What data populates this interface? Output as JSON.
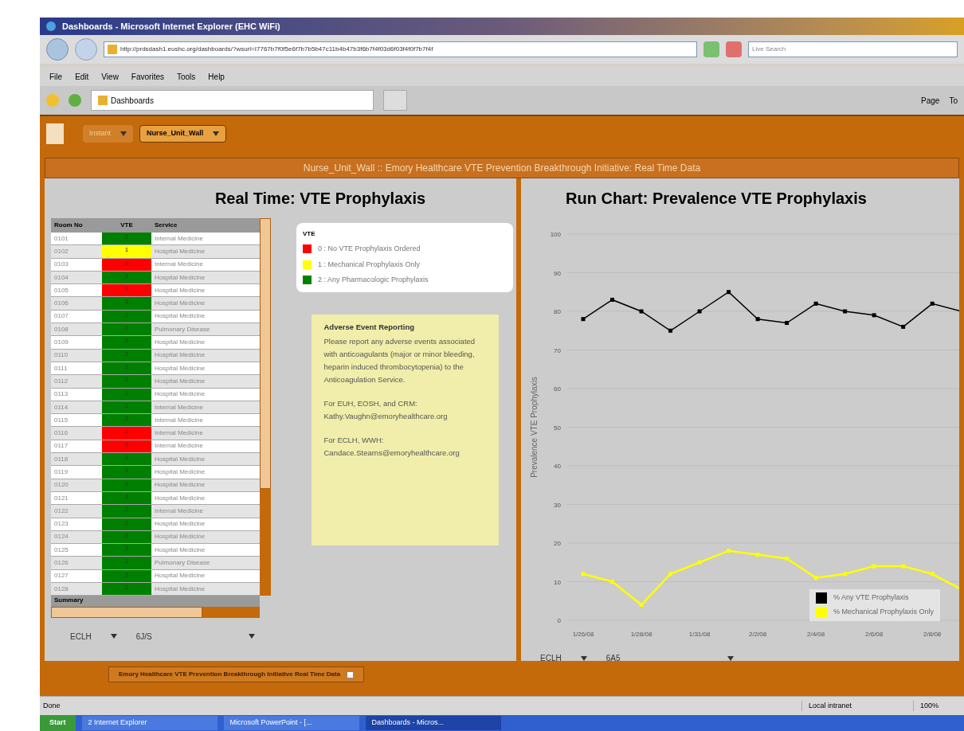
{
  "window": {
    "title": "Dashboards - Microsoft Internet Explorer (EHC WiFi)"
  },
  "address_bar": {
    "value": "http://prdsdash1.eushc.org/dashboards/?wsurl=I7767b7f0f5e6f7b7b5b47c11b4b47b3f6b7f4f03d6f03f4f0f7b7f4f",
    "search_placeholder": "Live Search"
  },
  "menu": [
    "File",
    "Edit",
    "View",
    "Favorites",
    "Tools",
    "Help"
  ],
  "browser_tab": {
    "label": "Dashboards"
  },
  "command_bar": [
    "Page",
    "To"
  ],
  "app_toolbar": [
    {
      "label": "Instant",
      "selected": false
    },
    {
      "label": "Nurse_Unit_Wall",
      "selected": true
    }
  ],
  "panel_title": "Nurse_Unit_Wall :: Emory Healthcare VTE Prevention Breakthrough Initiative: Real Time Data",
  "left_panel": {
    "title": "Real Time: VTE Prophylaxis",
    "table": {
      "columns": [
        "Room No",
        "VTE",
        "Service"
      ],
      "rows": [
        {
          "room": "0101",
          "vte": "2",
          "service": "Internal Medicine",
          "color": "#008000"
        },
        {
          "room": "0102",
          "vte": "1",
          "service": "Hospital Medicine",
          "color": "#ffff00"
        },
        {
          "room": "0103",
          "vte": "0",
          "service": "Internal Medicine",
          "color": "#ff0000"
        },
        {
          "room": "0104",
          "vte": "2",
          "service": "Hospital Medicine",
          "color": "#008000"
        },
        {
          "room": "0105",
          "vte": "0",
          "service": "Hospital Medicine",
          "color": "#ff0000"
        },
        {
          "room": "0106",
          "vte": "2",
          "service": "Hospital Medicine",
          "color": "#008000"
        },
        {
          "room": "0107",
          "vte": "2",
          "service": "Hospital Medicine",
          "color": "#008000"
        },
        {
          "room": "0108",
          "vte": "2",
          "service": "Pulmonary Disease",
          "color": "#008000"
        },
        {
          "room": "0109",
          "vte": "2",
          "service": "Hospital Medicine",
          "color": "#008000"
        },
        {
          "room": "0110",
          "vte": "2",
          "service": "Hospital Medicine",
          "color": "#008000"
        },
        {
          "room": "0111",
          "vte": "2",
          "service": "Hospital Medicine",
          "color": "#008000"
        },
        {
          "room": "0112",
          "vte": "2",
          "service": "Hospital Medicine",
          "color": "#008000"
        },
        {
          "room": "0113",
          "vte": "2",
          "service": "Hospital Medicine",
          "color": "#008000"
        },
        {
          "room": "0114",
          "vte": "2",
          "service": "Internal Medicine",
          "color": "#008000"
        },
        {
          "room": "0115",
          "vte": "2",
          "service": "Internal Medicine",
          "color": "#008000"
        },
        {
          "room": "0116",
          "vte": "0",
          "service": "Internal Medicine",
          "color": "#ff0000"
        },
        {
          "room": "0117",
          "vte": "0",
          "service": "Internal Medicine",
          "color": "#ff0000"
        },
        {
          "room": "0118",
          "vte": "2",
          "service": "Hospital Medicine",
          "color": "#008000"
        },
        {
          "room": "0119",
          "vte": "2",
          "service": "Hospital Medicine",
          "color": "#008000"
        },
        {
          "room": "0120",
          "vte": "2",
          "service": "Hospital Medicine",
          "color": "#008000"
        },
        {
          "room": "0121",
          "vte": "2",
          "service": "Hospital Medicine",
          "color": "#008000"
        },
        {
          "room": "0122",
          "vte": "2",
          "service": "Internal Medicine",
          "color": "#008000"
        },
        {
          "room": "0123",
          "vte": "2",
          "service": "Hospital Medicine",
          "color": "#008000"
        },
        {
          "room": "0124",
          "vte": "2",
          "service": "Hospital Medicine",
          "color": "#008000"
        },
        {
          "room": "0125",
          "vte": "2",
          "service": "Hospital Medicine",
          "color": "#008000"
        },
        {
          "room": "0126",
          "vte": "2",
          "service": "Pulmonary Disease",
          "color": "#008000"
        },
        {
          "room": "0127",
          "vte": "2",
          "service": "Hospital Medicine",
          "color": "#008000"
        },
        {
          "room": "0128",
          "vte": "2",
          "service": "Hospital Medicine",
          "color": "#008000"
        }
      ],
      "summary": "Summary"
    },
    "legend": {
      "title": "VTE",
      "items": [
        {
          "label": "0 : No VTE Prophylaxis Ordered",
          "color": "#ff0000"
        },
        {
          "label": "1 : Mechanical Prophylaxis Only",
          "color": "#ffff00"
        },
        {
          "label": "2 : Any Pharmacologic Prophylaxis",
          "color": "#008000"
        }
      ]
    },
    "note": {
      "title": "Adverse Event Reporting",
      "paragraphs": [
        "Please report any adverse events associated with anticoagulants (major or minor bleeding, heparin induced thrombocytopenia) to the Anticoagulation Service.",
        "For EUH, EOSH, and CRM: Kathy.Vaughn@emoryhealthcare.org",
        "For ECLH, WWH: Candace.Stearns@emoryhealthcare.org"
      ]
    },
    "filters": [
      "ECLH",
      "6J/S"
    ]
  },
  "right_panel": {
    "title": "Run Chart: Prevalence VTE Prophylaxis",
    "chart_data": {
      "type": "line",
      "ylabel": "Prevalence VTE Prophylaxis",
      "categories": [
        "1/26/08",
        null,
        "1/28/08",
        null,
        "1/31/08",
        null,
        "2/2/08",
        null,
        "2/4/08",
        null,
        "2/6/08",
        null,
        "2/8/08",
        null
      ],
      "ylim": [
        0,
        100
      ],
      "grid": true,
      "yticks": [
        0,
        10,
        20,
        30,
        40,
        50,
        60,
        70,
        80,
        90,
        100
      ],
      "series": [
        {
          "name": "% Any VTE Prophylaxis",
          "color": "#000000",
          "marker": "square",
          "values": [
            78,
            83,
            80,
            75,
            80,
            85,
            78,
            77,
            82,
            80,
            79,
            76,
            82,
            80
          ]
        },
        {
          "name": "% Mechanical Prophylaxis Only",
          "color": "#ffff00",
          "marker": "square",
          "values": [
            12,
            10,
            4,
            12,
            15,
            18,
            17,
            16,
            11,
            12,
            14,
            14,
            12,
            8
          ]
        }
      ]
    },
    "filters": [
      "ECLH",
      "6A5"
    ]
  },
  "bottom_tab": {
    "label": "Emory Healthcare VTE Prevention Breakthrough Initiative Real Time Data"
  },
  "status_bar": {
    "text": "Done",
    "zone": "Local intranet",
    "zoom": "100%"
  },
  "taskbar": {
    "start": "Start",
    "items": [
      "2 Internet Explorer",
      "Microsoft PowerPoint - [...",
      "Dashboards - Micros..."
    ]
  }
}
